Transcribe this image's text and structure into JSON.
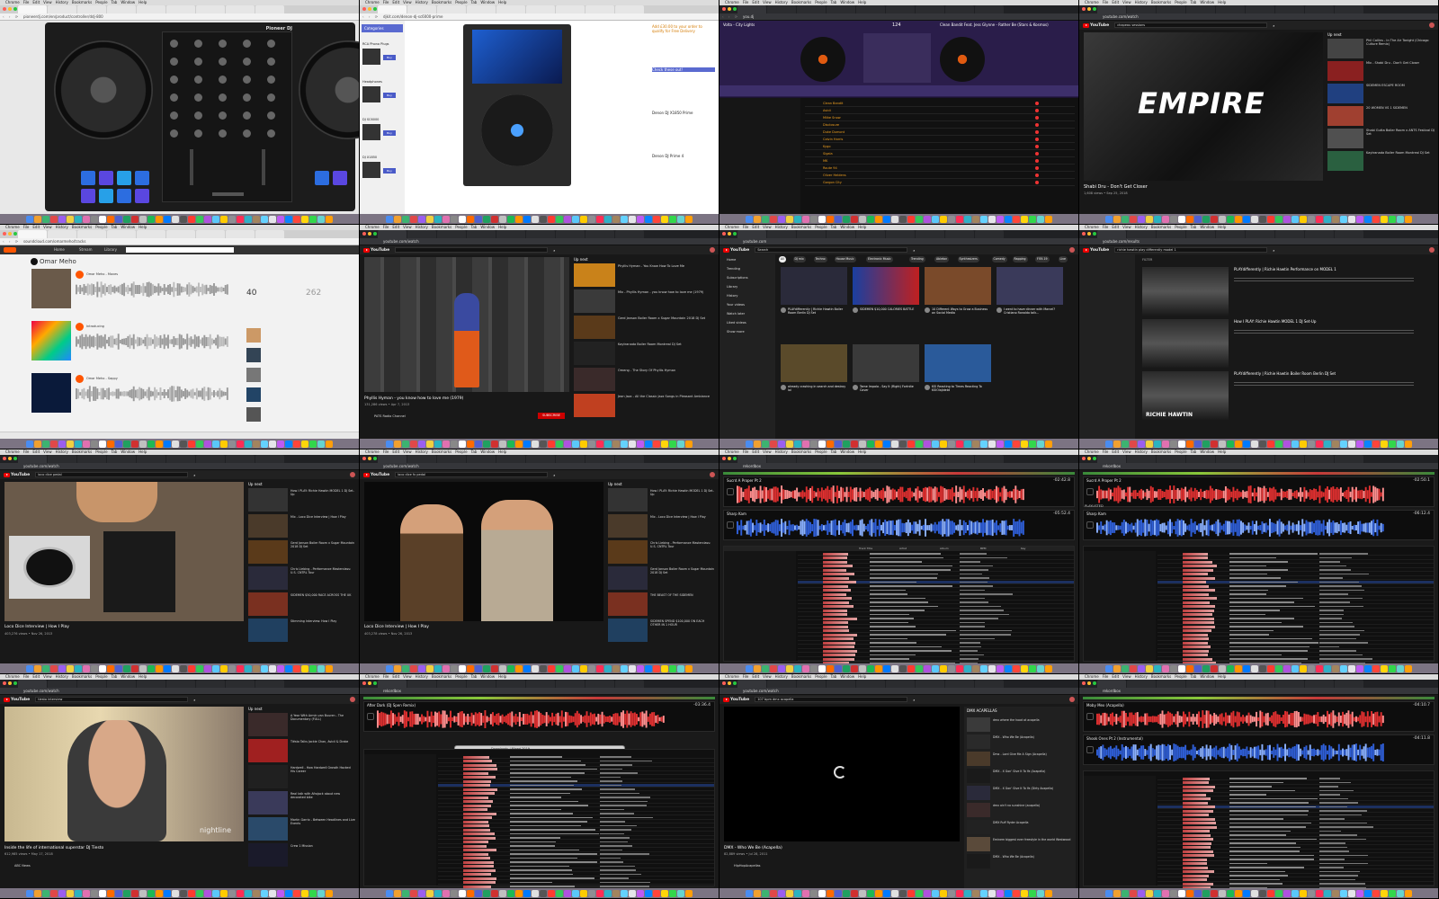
{
  "menu": {
    "apple": "",
    "chrome_items": [
      "Chrome",
      "File",
      "Edit",
      "View",
      "History",
      "Bookmarks",
      "People",
      "Tab",
      "Window",
      "Help"
    ]
  },
  "colors": {
    "yt_red": "#ee0000",
    "rb_red": "#e03030",
    "rb_blue": "#2f5fd8",
    "accent_orange": "#ff5500"
  },
  "tiles": {
    "t1": {
      "url": "pioneerdj.com/en/product/controller/ddj-800",
      "label": "Pioneer DJ",
      "device": "DDJ-800",
      "clock": "Sun 19:00"
    },
    "t2": {
      "url": "djkit.com/denon-dj-sc6000-prime",
      "categories": "Categories",
      "sidebar": [
        "RCA Phono Plugs",
        "Headphones",
        "DJ SC6000",
        "DJ X1850"
      ],
      "right": [
        "Add £30.00 to your order to qualify for Free Delivery",
        "Check these out!",
        "Denon DJ X1850 Prime",
        "Denon DJ Prime 4"
      ],
      "buy": "Buy"
    },
    "t3": {
      "url": "you.dj",
      "deck_a": "Volta - City Lights",
      "deck_b": "Clean Bandit Feat. Jess Glynne - Rather Be (Stars & Kosmos)",
      "bpm": "124",
      "tracks": [
        "Clean Bandit",
        "Avicii",
        "Miike Snow",
        "Disclosure",
        "Duke Dumont",
        "Calvin Harris",
        "Kygo",
        "Sigala",
        "MK",
        "Route 94",
        "Oliver Heldens",
        "Gorgon City"
      ]
    },
    "t4": {
      "search": "chapeau sessions",
      "banner": "EMPIRE",
      "title": "Shabi Dru - Don't Get Closer",
      "meta": "1,608 views • Sep 25, 2018",
      "upnext": "Up next",
      "items": [
        "Phil Collins - In The Air Tonight (Chicago Culture Remix)",
        "Mix - Shabi Dru - Don't Get Closer",
        "SIDEMEN ESCAPE ROOM",
        "20 WOMEN VS 1 SIDEMEN",
        "Shabi Gutta Boiler Room x ANTS Festival DJ Set",
        "Kaytranada Boiler Room Montreal DJ Set"
      ]
    },
    "t5": {
      "url": "soundcloud.com/omarmeho/tracks",
      "nav": [
        "Home",
        "Stream",
        "Library"
      ],
      "profile": "Omar Meho",
      "tracks": [
        "Omar Meho - Moves",
        "Introducing",
        "Omar Meho - Sappy"
      ],
      "stats": [
        "40",
        "262"
      ]
    },
    "t6": {
      "title": "Phyllis Hyman - you know how to love me (1979)",
      "meta": "131,286 views • Apr 7, 2013",
      "channel": "PATS Radio Channel",
      "subscribe": "SUBSCRIBE",
      "upnext": "Up next",
      "items": [
        "Phyllis Hyman - You Know How To Love Me",
        "Mix - Phyllis Hyman - you know how to love me (1979)",
        "Gerd Janson Boiler Room x Sugar Mountain 2018 DJ Set",
        "Kaytranada Boiler Room Montreal DJ Set",
        "Omeng - The Story Of Phyllis Hyman",
        "Jean Jazz - All the Classic Jazz Songs in Pleasant Ambiance"
      ]
    },
    "t7": {
      "search": "Search",
      "chips": [
        "All",
        "DJ mix",
        "Techno",
        "House Music",
        "Electronic Music",
        "Trending",
        "Ableton",
        "Synthesizers",
        "Comedy",
        "Rapping",
        "FIFA 19",
        "Live"
      ],
      "side": [
        "Home",
        "Trending",
        "Subscriptions",
        "Library",
        "History",
        "Your videos",
        "Watch later",
        "Liked videos",
        "Show more"
      ],
      "cards": [
        "PLAYdifferently | Richie Hawtin Boiler Room Berlin DJ Set",
        "SIDEMEN $10,000 CALORIES BATTLE",
        "10 Different Ways to Grow a Business on Social Media",
        "I went to have dinner with Marcel? Cristiano Ronaldo talk...",
        "already crashing in search and destroy lol",
        "Tame Impala - Say It (Right) Fortnite Cover",
        "KSI Reacting to Times Reacting To KSIOlajidebt"
      ]
    },
    "t8": {
      "search": "richie hawtin play differently model 1",
      "filter": "FILTER",
      "results": [
        "PLAYdifferently | Richie Hawtin Performance on MODEL 1",
        "How I PLAY: Richie Hawtin MODEL 1 DJ Set-Up",
        "PLAYdifferently | Richie Hawtin Boiler Room Berlin DJ Set"
      ],
      "overlay": "RICHIE HAWTIN"
    },
    "t9": {
      "search": "loco dice pedal",
      "title": "Loco Dice Interview | How I Play",
      "meta": "403,276 views • Nov 26, 2013",
      "upnext": "Up next",
      "items": [
        "How I PLAY: Richie Hawtin MODEL 1 DJ Set-Up",
        "Mix - Loco Dice Interview | How I Play",
        "Gerd Janson Boiler Room x Sugar Mountain 2018 DJ Set",
        "Chris Liebing - Performance Masterclass: U.S. CNTRL Tour",
        "SIDEMEN $50,000 RACE ACROSS THE UK",
        "Stimming Interview: How I Play"
      ]
    },
    "t10": {
      "search": "loco dice fx pedal",
      "title": "Loco Dice Interview | How I Play",
      "meta": "403,278 views • Nov 26, 2013",
      "upnext": "Up next",
      "items": [
        "How I PLAY: Richie Hawtin MODEL 1 DJ Set-Up",
        "Mix - Loco Dice Interview | How I Play",
        "Chris Liebing - Performance Masterclass: U.S. CNTRL Tour",
        "Gerd Janson Boiler Room x Sugar Mountain 2018 DJ Set",
        "THE BEAST OF THE SIDEMEN",
        "SIDEMEN SPEND $100,000 ON EACH OTHER IN 1 HOUR"
      ]
    },
    "t11": {
      "deck_a": "Sucrd A Proper Pt 2",
      "deck_b": "Sharp Kam",
      "time_a": "-02:42.8",
      "time_b": "-05:52.4",
      "browser_header": [
        "Track Title",
        "Artist",
        "Album",
        "BPM",
        "Key"
      ]
    },
    "t12": {
      "deck_a": "Sucrd A Proper Pt 2",
      "deck_b": "Sharp Kam",
      "time_a": "-02:50.1",
      "time_b": "-06:12.4",
      "status": "PLAYLISTED"
    },
    "t13": {
      "search": "tiesto interview",
      "title": "Inside the life of international superstar DJ Tiesto",
      "meta": "612,985 views • May 17, 2018",
      "channel": "ABC News",
      "watermark": "nightline",
      "upnext": "Up next",
      "items": [
        "A Year With Armin van Buuren - The Documentary (FULL)",
        "Tiësto Talks Jackie Chan, Avicii & Drake",
        "Hardwell - How Hardwell Growth Hacked His Career",
        "Real talk with Afrojack about new decorated bike",
        "Martin Garrix - Between Headlines and Live Events",
        "Crew 1 Mission"
      ]
    },
    "t14": {
      "deck_a": "After Dark (DJ Spen Remix)",
      "time_a": "-03:36.4",
      "folder": "Downloads",
      "dialog_title": "Downloads / Mixed 2019",
      "files": [
        "Maine Event - Fun Tonite.mp3",
        "Frank Stavas - Stumbling Dist.mp3",
        "Heavy Dame - Fisher (Acid).mp3",
        "Bob Pi Busk - My Soul.mp3",
        "Boogie Boy - Reborn.mp3"
      ],
      "sidebar": [
        "Favorites",
        "Dropbox",
        "Desktop",
        "Documents",
        "Applications",
        "Downloads"
      ]
    },
    "t15": {
      "search": "107 bpm dmx acapella",
      "title": "DMX - Who We Be (Acapella)",
      "meta": "82,889 views • Jul 28, 2011",
      "channel": "HipHopAcapellas",
      "side_title": "DMX ACAPELLAS",
      "items": [
        "dmx where the hood at acapella",
        "DMX - Who We Be (Acapella)",
        "Dmx - Lord Give Me A Sign (Acapella)",
        "DMX - X Gon' Give It To Ya (Acapella)",
        "DMX - X Gon' Give It To Ya (Dirty Acapella)",
        "dmx ain't no sunshine (acapella)",
        "DMX Ruff Ryder Acapella",
        "Eminem biggest ever freestyle in the world Westwood",
        "DMX - Who We Be (Acapella)"
      ]
    },
    "t16": {
      "deck_a": "Moby Mex (Acapella)",
      "deck_b": "Shook Ones Pt 2 (Instrumental)",
      "time_a": "-04:10.7",
      "time_b": "-04:11.8"
    }
  }
}
